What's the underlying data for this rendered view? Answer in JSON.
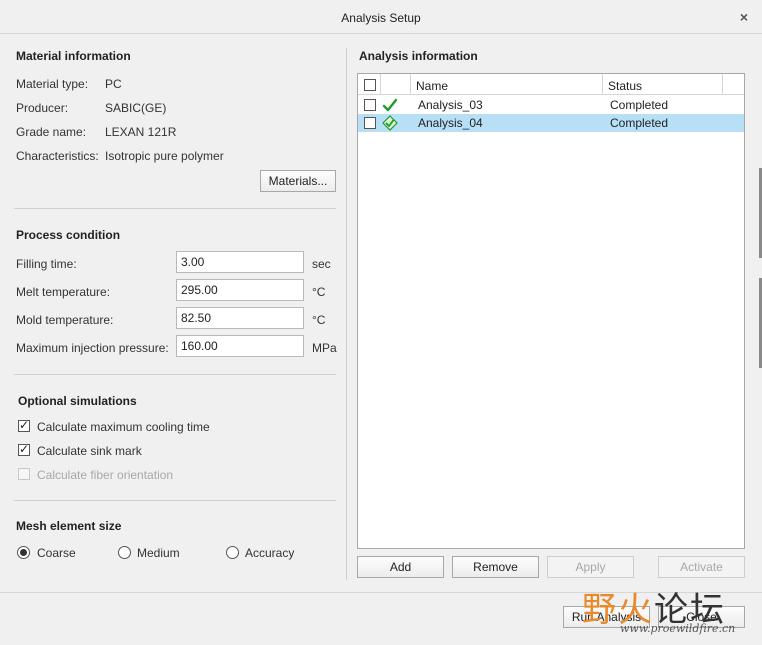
{
  "window": {
    "title": "Analysis Setup",
    "close_glyph": "×"
  },
  "material": {
    "heading": "Material information",
    "rows": [
      {
        "label": "Material type:",
        "value": "PC"
      },
      {
        "label": "Producer:",
        "value": "SABIC(GE)"
      },
      {
        "label": "Grade name:",
        "value": "LEXAN 121R"
      },
      {
        "label": "Characteristics:",
        "value": "Isotropic pure polymer"
      }
    ],
    "button": "Materials..."
  },
  "process": {
    "heading": "Process condition",
    "fields": [
      {
        "label": "Filling time:",
        "value": "3.00",
        "unit": "sec"
      },
      {
        "label": "Melt temperature:",
        "value": "295.00",
        "unit": "°C"
      },
      {
        "label": "Mold temperature:",
        "value": "82.50",
        "unit": "°C"
      },
      {
        "label": "Maximum injection pressure:",
        "value": "160.00",
        "unit": "MPa"
      }
    ]
  },
  "optional": {
    "heading": "Optional simulations",
    "items": [
      {
        "label": "Calculate maximum cooling time",
        "checked": true,
        "enabled": true
      },
      {
        "label": "Calculate sink mark",
        "checked": true,
        "enabled": true
      },
      {
        "label": "Calculate fiber orientation",
        "checked": false,
        "enabled": false
      }
    ]
  },
  "mesh": {
    "heading": "Mesh element size",
    "options": [
      {
        "label": "Coarse",
        "selected": true
      },
      {
        "label": "Medium",
        "selected": false
      },
      {
        "label": "Accuracy",
        "selected": false
      }
    ]
  },
  "analysis": {
    "heading": "Analysis information",
    "columns": [
      "Name",
      "Status"
    ],
    "rows": [
      {
        "name": "Analysis_03",
        "status": "Completed",
        "icon": "checkmark-icon",
        "selected": false
      },
      {
        "name": "Analysis_04",
        "status": "Completed",
        "icon": "active-analysis-icon",
        "selected": true
      }
    ],
    "buttons": {
      "add": "Add",
      "remove": "Remove",
      "apply": "Apply",
      "activate": "Activate"
    }
  },
  "footer": {
    "run": "Run Analysis",
    "close": "Close"
  },
  "watermark": {
    "chars1": "野火",
    "chars2": "论坛",
    "url": "www.proewildfire.cn"
  },
  "colors": {
    "selection": "#b7e0f6",
    "check_green": "#1e9e2a",
    "watermark_orange": "#e88a2a"
  }
}
